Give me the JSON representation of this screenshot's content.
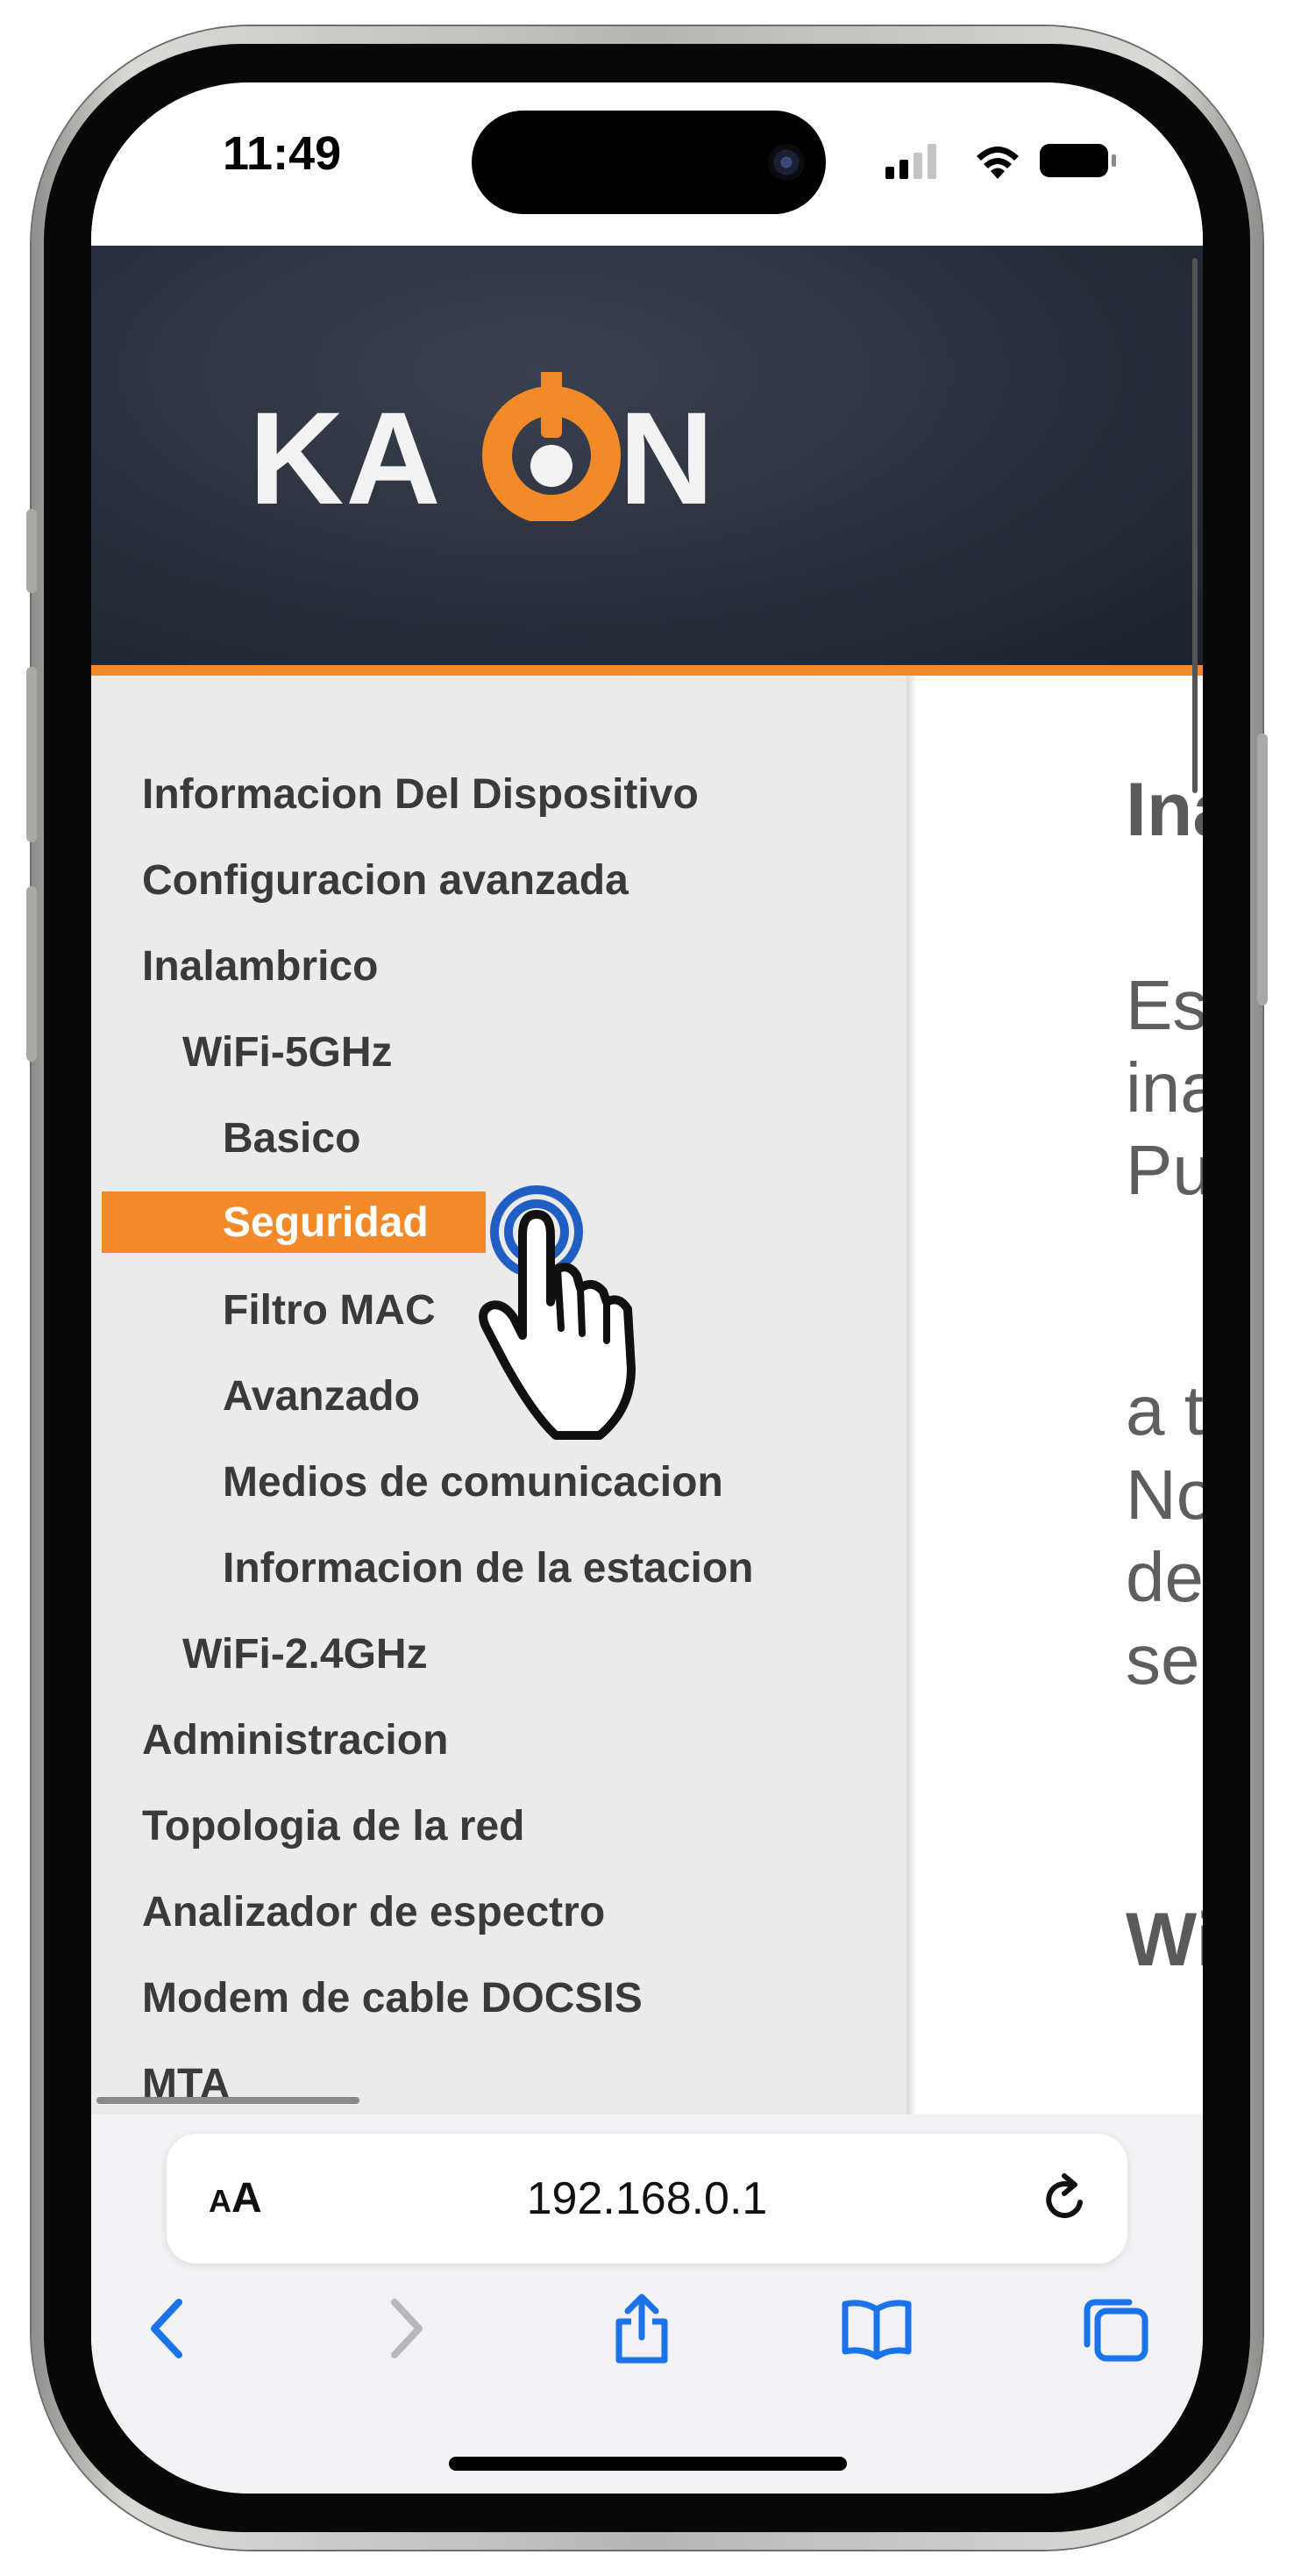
{
  "status_bar": {
    "time": "11:49"
  },
  "banner": {
    "logo_text": "KAON",
    "brand_color": "#f28a2a"
  },
  "sidebar": {
    "items": [
      {
        "label": "Informacion Del Dispositivo",
        "level": 0,
        "active": false
      },
      {
        "label": "Configuracion avanzada",
        "level": 0,
        "active": false
      },
      {
        "label": "Inalambrico",
        "level": 0,
        "active": false
      },
      {
        "label": "WiFi-5GHz",
        "level": 1,
        "active": false
      },
      {
        "label": "Basico",
        "level": 2,
        "active": false
      },
      {
        "label": "Seguridad",
        "level": 2,
        "active": true
      },
      {
        "label": "Filtro MAC",
        "level": 2,
        "active": false
      },
      {
        "label": "Avanzado",
        "level": 2,
        "active": false
      },
      {
        "label": "Medios de comunicacion",
        "level": 2,
        "active": false
      },
      {
        "label": "Informacion de la estacion",
        "level": 2,
        "active": false
      },
      {
        "label": "WiFi-2.4GHz",
        "level": 1,
        "active": false
      },
      {
        "label": "Administracion",
        "level": 0,
        "active": false
      },
      {
        "label": "Topologia de la red",
        "level": 0,
        "active": false
      },
      {
        "label": "Analizador de espectro",
        "level": 0,
        "active": false
      },
      {
        "label": "Modem de cable DOCSIS",
        "level": 0,
        "active": false
      },
      {
        "label": "MTA",
        "level": 0,
        "active": false
      }
    ]
  },
  "content": {
    "heading": "Ina",
    "lines": [
      "Es",
      "ina",
      "Pu",
      "a t",
      "No",
      "de",
      "se"
    ],
    "subheading": "Wi"
  },
  "browser": {
    "aa_small": "A",
    "aa_big": "A",
    "url": "192.168.0.1",
    "icons": {
      "back": "chevron-left-icon",
      "forward": "chevron-right-icon",
      "share": "share-icon",
      "bookmarks": "book-icon",
      "tabs": "tabs-icon",
      "reload": "reload-icon"
    },
    "accent": "#1a73e8"
  }
}
